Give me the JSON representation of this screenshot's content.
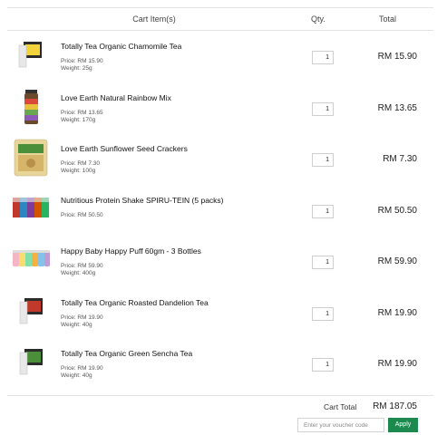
{
  "header": {
    "items": "Cart Item(s)",
    "qty": "Qty.",
    "total": "Total"
  },
  "items": [
    {
      "name": "Totally Tea Organic Chamomile Tea",
      "price": "Price: RM 15.90",
      "weight": "Weight: 25g",
      "qty": "1",
      "total": "RM 15.90",
      "image": "tea-box"
    },
    {
      "name": "Love Earth Natural Rainbow Mix",
      "price": "Price: RM 13.65",
      "weight": "Weight: 170g",
      "qty": "1",
      "total": "RM 13.65",
      "image": "jar"
    },
    {
      "name": "Love Earth Sunflower Seed Crackers",
      "price": "Price: RM 7.30",
      "weight": "Weight: 100g",
      "qty": "1",
      "total": "RM 7.30",
      "image": "cracker-pack"
    },
    {
      "name": "Nutritious Protein Shake SPIRU-TEIN (5 packs)",
      "price": "Price: RM 50.50",
      "weight": "",
      "qty": "1",
      "total": "RM 50.50",
      "image": "sachets"
    },
    {
      "name": "Happy Baby Happy Puff 60gm - 3 Bottles",
      "price": "Price: RM 59.90",
      "weight": "Weight: 400g",
      "qty": "1",
      "total": "RM 59.90",
      "image": "bottles"
    },
    {
      "name": "Totally Tea Organic Roasted Dandelion Tea",
      "price": "Price: RM 19.90",
      "weight": "Weight: 40g",
      "qty": "1",
      "total": "RM 19.90",
      "image": "tea-box-red"
    },
    {
      "name": "Totally Tea Organic Green Sencha Tea",
      "price": "Price: RM 19.90",
      "weight": "Weight: 40g",
      "qty": "1",
      "total": "RM 19.90",
      "image": "tea-box-green"
    }
  ],
  "footer": {
    "cart_total_label": "Cart Total",
    "cart_total_value": "RM 187.05",
    "voucher_placeholder": "Enter your voucher code",
    "apply_label": "Apply"
  },
  "colors": {
    "accent": "#1c8a4f",
    "border": "#e3e3e3"
  }
}
